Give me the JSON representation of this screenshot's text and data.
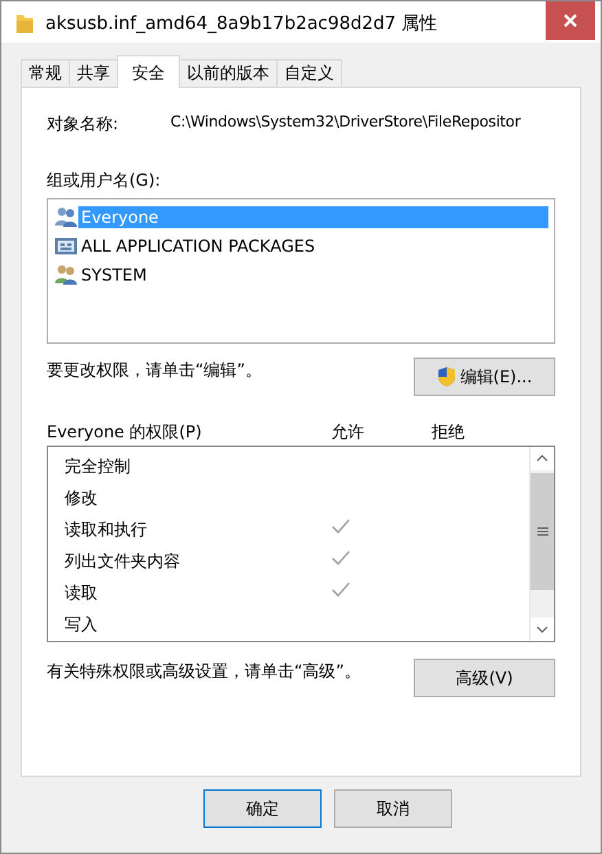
{
  "window": {
    "title": "aksusb.inf_amd64_8a9b17b2ac98d2d7 属性"
  },
  "tabs": [
    {
      "label": "常规",
      "selected": false
    },
    {
      "label": "共享",
      "selected": false
    },
    {
      "label": "安全",
      "selected": true
    },
    {
      "label": "以前的版本",
      "selected": false
    },
    {
      "label": "自定义",
      "selected": false
    }
  ],
  "object_name": {
    "label": "对象名称:",
    "value": "C:\\Windows\\System32\\DriverStore\\FileRepositor"
  },
  "groups": {
    "label": "组或用户名(G):",
    "items": [
      {
        "name": "Everyone",
        "kind": "group",
        "selected": true
      },
      {
        "name": "ALL APPLICATION PACKAGES",
        "kind": "package",
        "selected": false
      },
      {
        "name": "SYSTEM",
        "kind": "system",
        "selected": false
      }
    ]
  },
  "edit_hint": "要更改权限，请单击“编辑”。",
  "edit_button": "编辑(E)...",
  "permissions": {
    "title": "Everyone 的权限(P)",
    "columns": [
      "允许",
      "拒绝"
    ],
    "rows": [
      {
        "name": "完全控制",
        "allow": false
      },
      {
        "name": "修改",
        "allow": false
      },
      {
        "name": "读取和执行",
        "allow": true
      },
      {
        "name": "列出文件夹内容",
        "allow": true
      },
      {
        "name": "读取",
        "allow": true
      },
      {
        "name": "写入",
        "allow": false
      }
    ]
  },
  "advanced_hint": "有关特殊权限或高级设置，请单击“高级”。",
  "advanced_button": "高级(V)",
  "buttons": [
    "确定",
    "取消"
  ]
}
